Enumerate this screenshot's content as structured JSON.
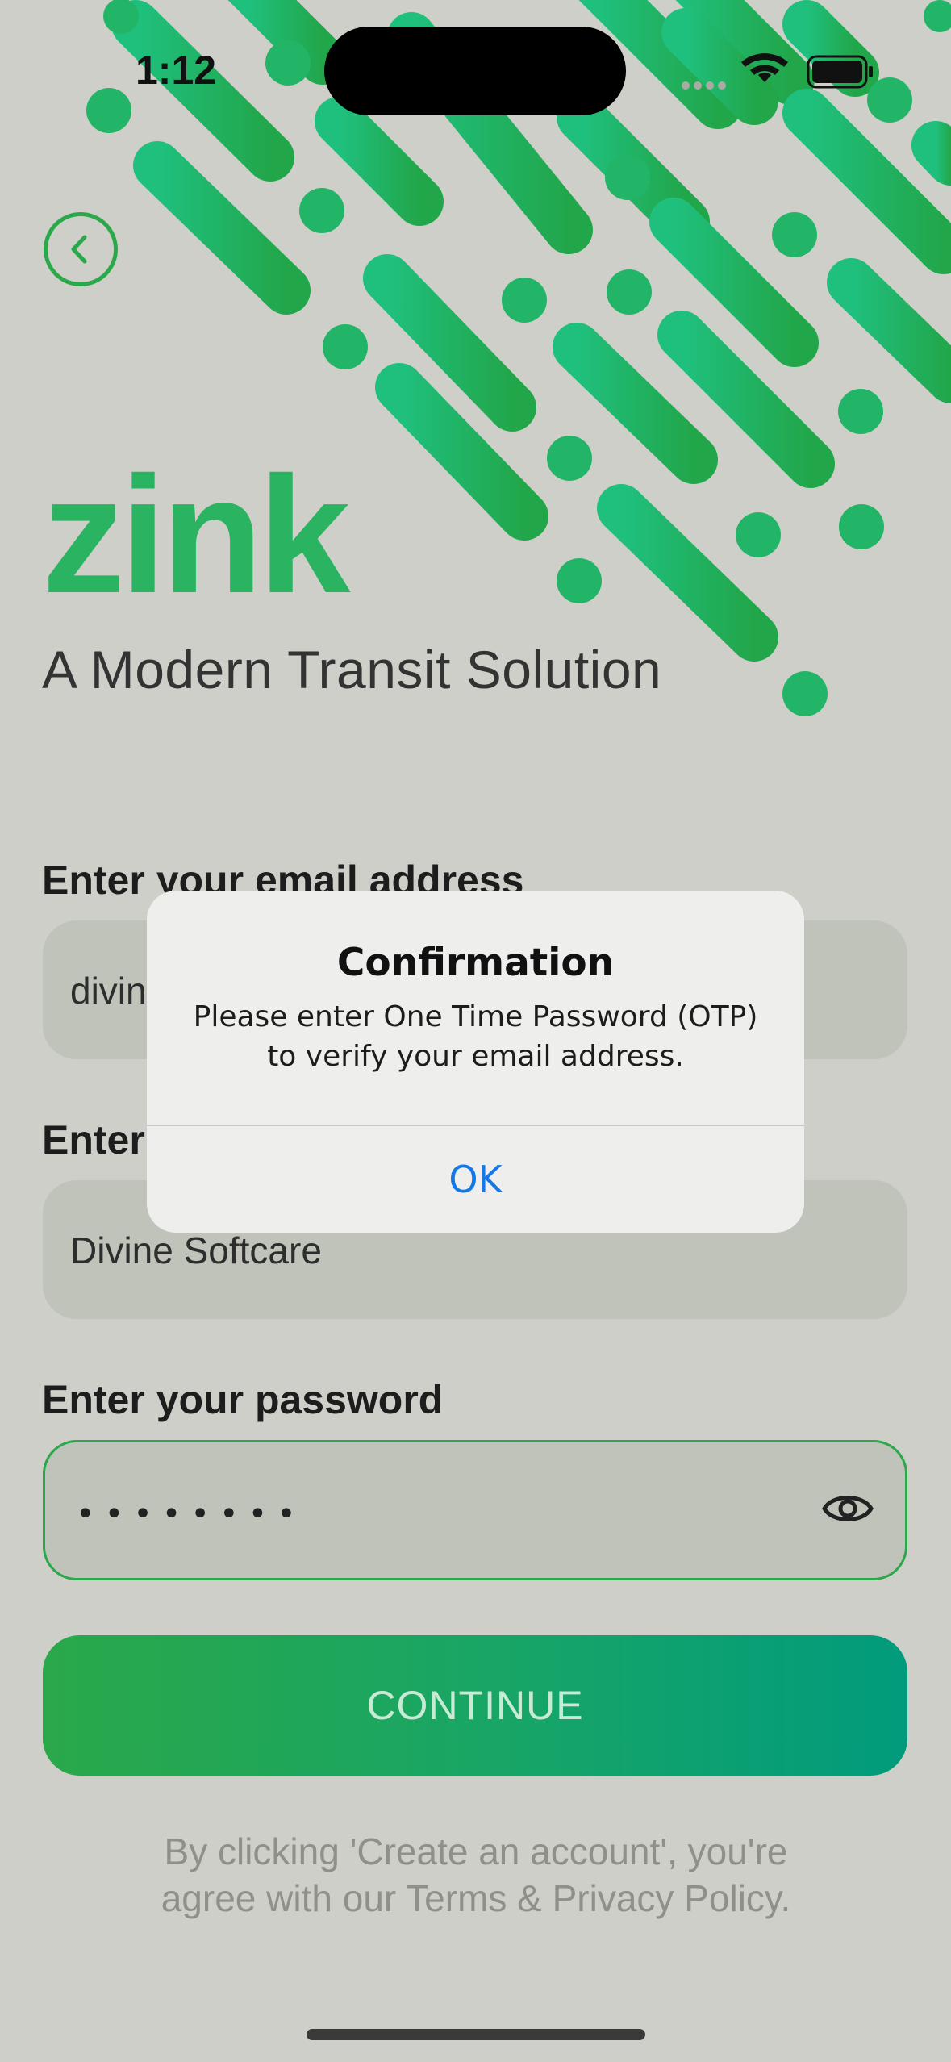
{
  "status_bar": {
    "time": "1:12"
  },
  "brand": {
    "logo": "zink",
    "tagline": "A Modern Transit Solution",
    "accent": "#2ab361"
  },
  "form": {
    "email": {
      "label": "Enter your email address",
      "value": "divine"
    },
    "name": {
      "label": "Enter your name",
      "value": "Divine Softcare"
    },
    "password": {
      "label": "Enter your password",
      "masked_value": "••••••••"
    },
    "continue_label": "CONTINUE",
    "terms_line1": "By clicking 'Create an account', you're",
    "terms_line2": "agree with our Terms & Privacy Policy."
  },
  "dialog": {
    "title": "Confirmation",
    "message_line1": "Please enter One Time Password (OTP)",
    "message_line2": "to verify your email address.",
    "ok_label": "OK"
  },
  "icons": [
    "back-chevron-icon",
    "wifi-icon",
    "battery-icon",
    "eye-icon"
  ]
}
